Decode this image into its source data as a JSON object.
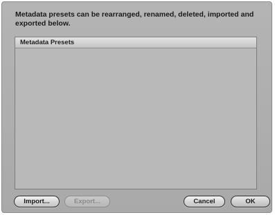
{
  "dialog": {
    "description": "Metadata presets can be rearranged, renamed, deleted, imported and exported below."
  },
  "presets_list": {
    "header": "Metadata Presets",
    "items": []
  },
  "buttons": {
    "import_label": "Import...",
    "export_label": "Export...",
    "cancel_label": "Cancel",
    "ok_label": "OK"
  }
}
